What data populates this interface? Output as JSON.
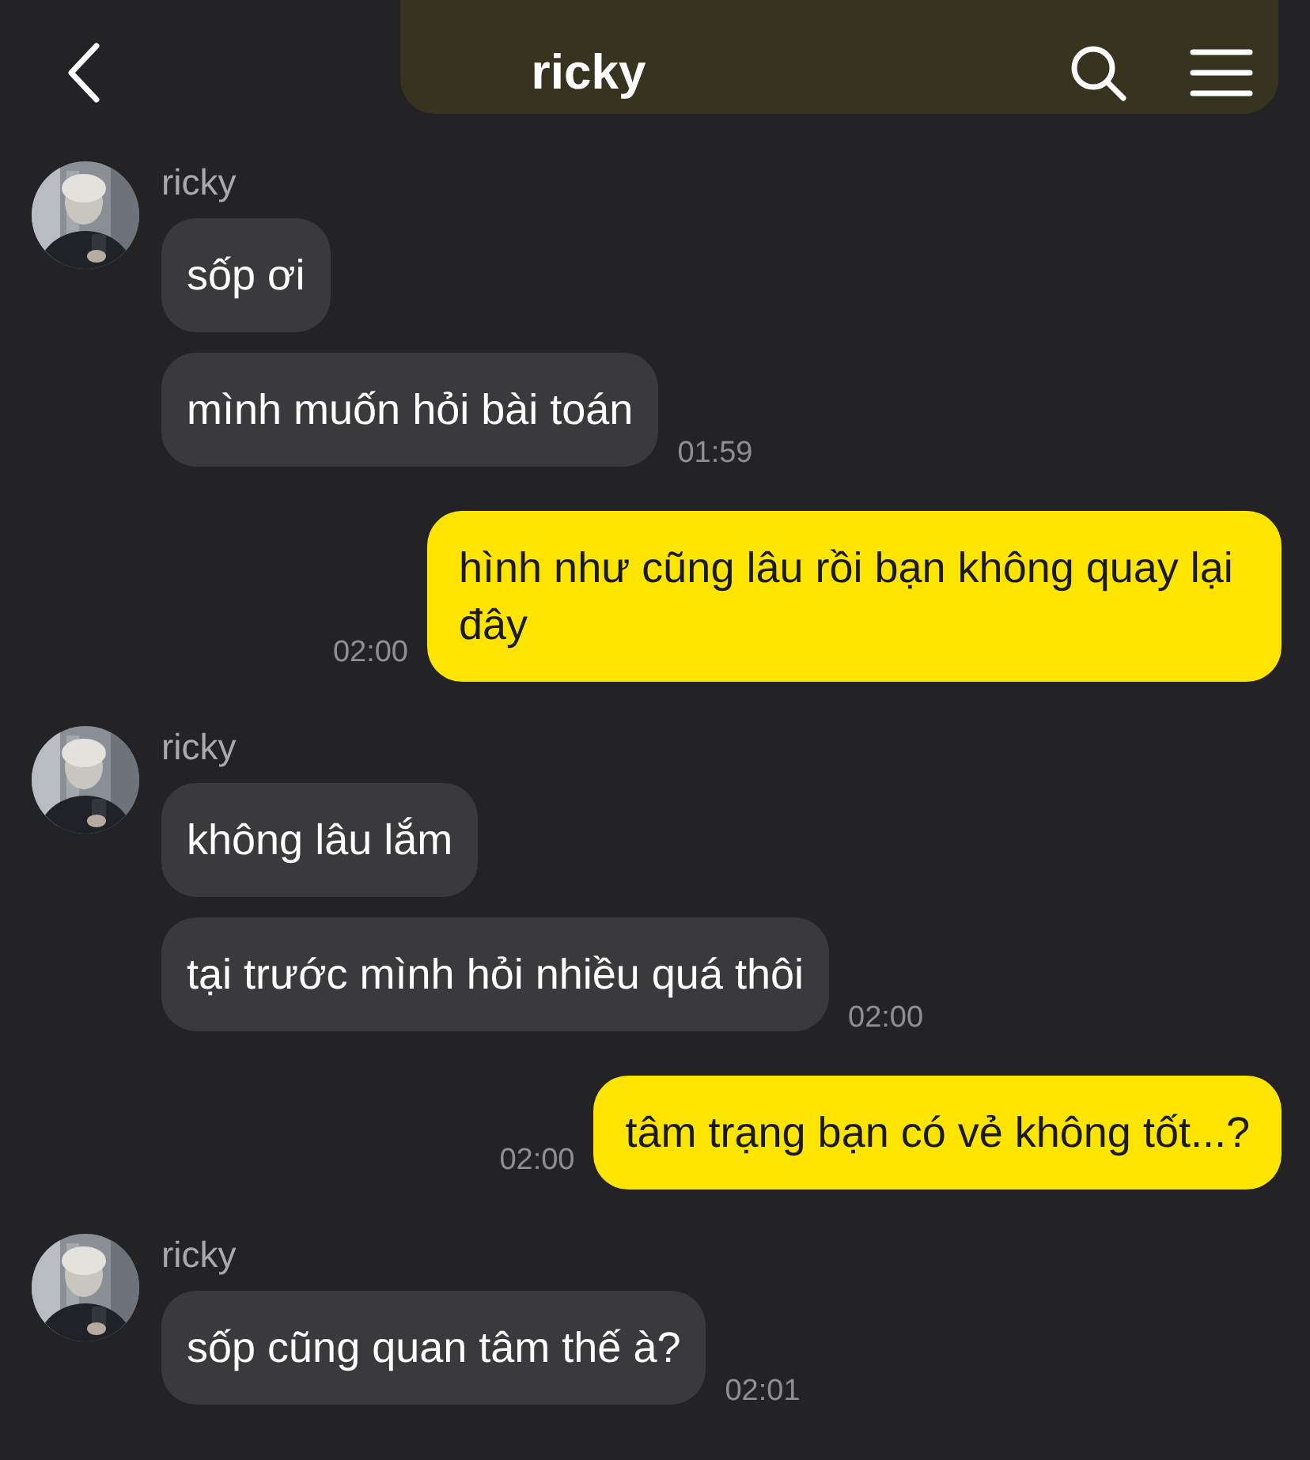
{
  "header": {
    "title": "ricky"
  },
  "messages": [
    {
      "kind": "received",
      "sender": "ricky",
      "bubbles": [
        {
          "text": "sốp ơi"
        },
        {
          "text": "mình muốn hỏi bài toán",
          "time": "01:59"
        }
      ]
    },
    {
      "kind": "sent",
      "text": "hình như cũng lâu rồi bạn không quay lại đây",
      "time": "02:00"
    },
    {
      "kind": "received",
      "sender": "ricky",
      "bubbles": [
        {
          "text": "không lâu lắm"
        },
        {
          "text": "tại trước mình hỏi nhiều quá thôi",
          "time": "02:00"
        }
      ]
    },
    {
      "kind": "sent",
      "text": "tâm trạng bạn có vẻ không tốt...?",
      "time": "02:00"
    },
    {
      "kind": "received",
      "sender": "ricky",
      "bubbles": [
        {
          "text": "sốp cũng quan tâm thế à?",
          "time": "02:01"
        }
      ]
    }
  ]
}
